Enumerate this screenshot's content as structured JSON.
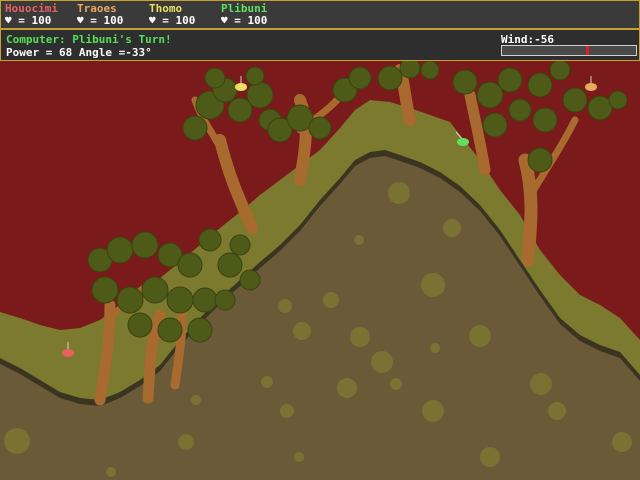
{
  "players": [
    {
      "name": "Houocimi",
      "health": "♥ = 100",
      "color": "#e86060"
    },
    {
      "name": "Traoes",
      "health": "♥ = 100",
      "color": "#e8a860"
    },
    {
      "name": "Thomo",
      "health": "♥ = 100",
      "color": "#e8e060"
    },
    {
      "name": "Plibuni",
      "health": "♥ = 100",
      "color": "#60e060"
    }
  ],
  "status": {
    "turn_text": "Computer: Plibuni's Turn!",
    "power_angle": "Power = 68  Angle =-33°",
    "wind_label": "Wind:-56",
    "wind_value": -56
  },
  "colors": {
    "sky": "#7a1a1a",
    "grass": "#7c7a2e",
    "dirt": "#6a5a38",
    "foliage": "#4d5a18",
    "trunk": "#a86a2e",
    "hud_border": "#c8a030"
  },
  "tanks": [
    {
      "owner": "Thomo",
      "color": "#e8e060"
    },
    {
      "owner": "Traoes",
      "color": "#e8a860"
    },
    {
      "owner": "Plibuni",
      "color": "#60e060"
    },
    {
      "owner": "Houocimi",
      "color": "#e86060"
    }
  ]
}
